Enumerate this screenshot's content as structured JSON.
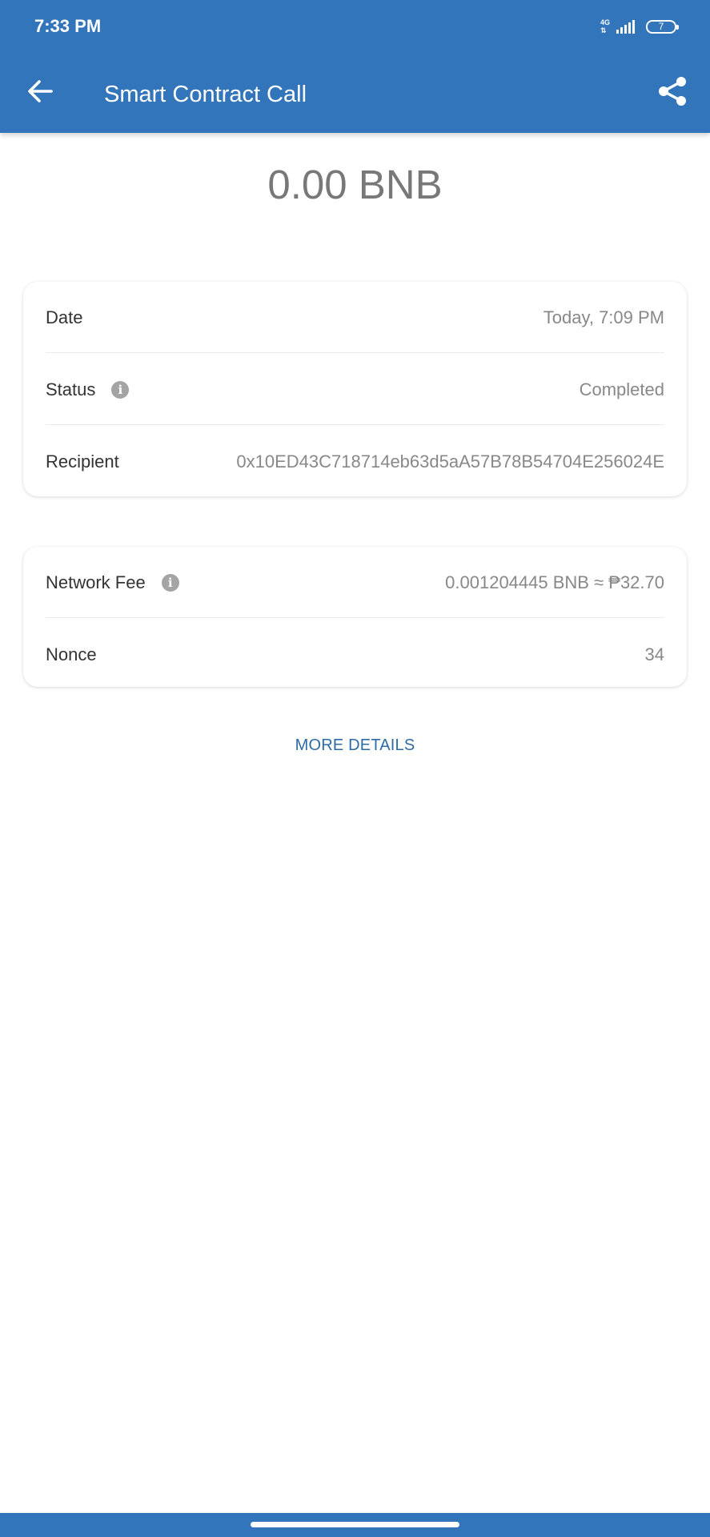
{
  "status_bar": {
    "time": "7:33 PM",
    "network": "4G",
    "battery": "7"
  },
  "app_bar": {
    "title": "Smart Contract Call",
    "back_icon": "arrow-left-icon",
    "share_icon": "share-icon",
    "color": "#3375bb"
  },
  "amount": "0.00 BNB",
  "details": {
    "date_label": "Date",
    "date_value": "Today, 7:09 PM",
    "status_label": "Status",
    "status_value": "Completed",
    "recipient_label": "Recipient",
    "recipient_value": "0x10ED43C718714eb63d5aA57B78B54704E256024E"
  },
  "fees": {
    "network_fee_label": "Network Fee",
    "network_fee_value": "0.001204445 BNB ≈ ₱32.70",
    "nonce_label": "Nonce",
    "nonce_value": "34"
  },
  "more_details_label": "MORE DETAILS",
  "colors": {
    "primary": "#3375bb",
    "link": "#2d6ba5",
    "muted_text": "#888888"
  }
}
